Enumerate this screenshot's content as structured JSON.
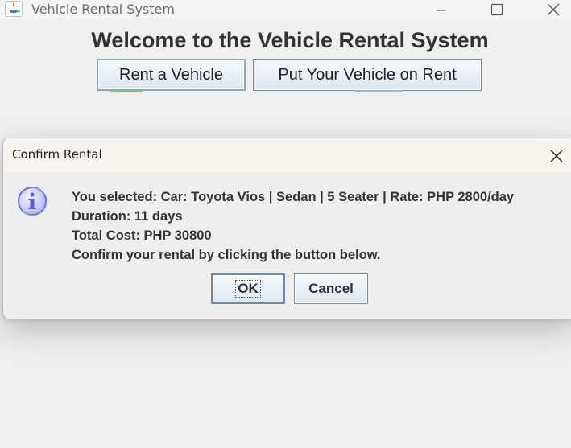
{
  "window": {
    "title": "Vehicle Rental System",
    "app_icon": "java-icon",
    "controls": [
      "minimize-icon",
      "maximize-icon",
      "close-icon"
    ]
  },
  "main": {
    "welcome": "Welcome to the Vehicle Rental System",
    "rent_button": "Rent a Vehicle",
    "put_button": "Put Your Vehicle on Rent"
  },
  "dialog": {
    "title": "Confirm Rental",
    "icon": "info-icon",
    "lines": [
      "You selected: Car: Toyota Vios | Sedan | 5 Seater | Rate: PHP 2800/day",
      "Duration: 11 days",
      "Total Cost: PHP 30800",
      "Confirm your rental by clicking the button below."
    ],
    "ok_label": "OK",
    "cancel_label": "Cancel"
  },
  "colors": {
    "background": "#efefef",
    "button_border": "#7a8a99",
    "info_icon": "#6b6fd6"
  }
}
